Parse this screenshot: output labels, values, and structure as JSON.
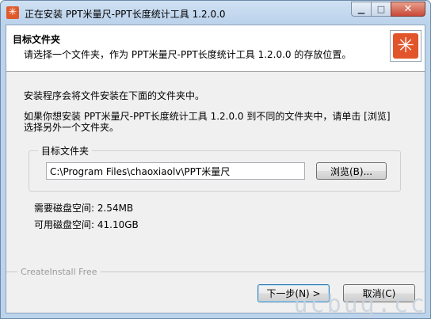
{
  "window": {
    "title": "正在安装 PPT米量尺-PPT长度统计工具 1.2.0.0",
    "app_icon": "asterisk-app-icon",
    "controls": {
      "minimize": "▁",
      "maximize": "□",
      "close": "✕"
    }
  },
  "header": {
    "title": "目标文件夹",
    "subtitle": "请选择一个文件夹，作为 PPT米量尺-PPT长度统计工具 1.2.0.0 的存放位置。",
    "logo_glyph": "✳"
  },
  "body": {
    "line1": "安装程序会将文件安装在下面的文件夹中。",
    "line2": "如果你想安装 PPT米量尺-PPT长度统计工具 1.2.0.0 到不同的文件夹中，请单击 [浏览]",
    "line3": "选择另外一个文件夹。"
  },
  "destination": {
    "group_label": "目标文件夹",
    "path_value": "C:\\Program Files\\chaoxiaolv\\PPT米量尺",
    "browse_label": "浏览(B)..."
  },
  "disk": {
    "required": "需要磁盘空间: 2.54MB",
    "available": "可用磁盘空间: 41.10GB"
  },
  "footer": {
    "branding": "CreateInstall Free",
    "next_label": "下一步(N) >",
    "cancel_label": "取消(C)"
  },
  "watermark": "ucbug.cc",
  "colors": {
    "accent": "#e2542a",
    "title_bar": "#bcd3ec"
  }
}
